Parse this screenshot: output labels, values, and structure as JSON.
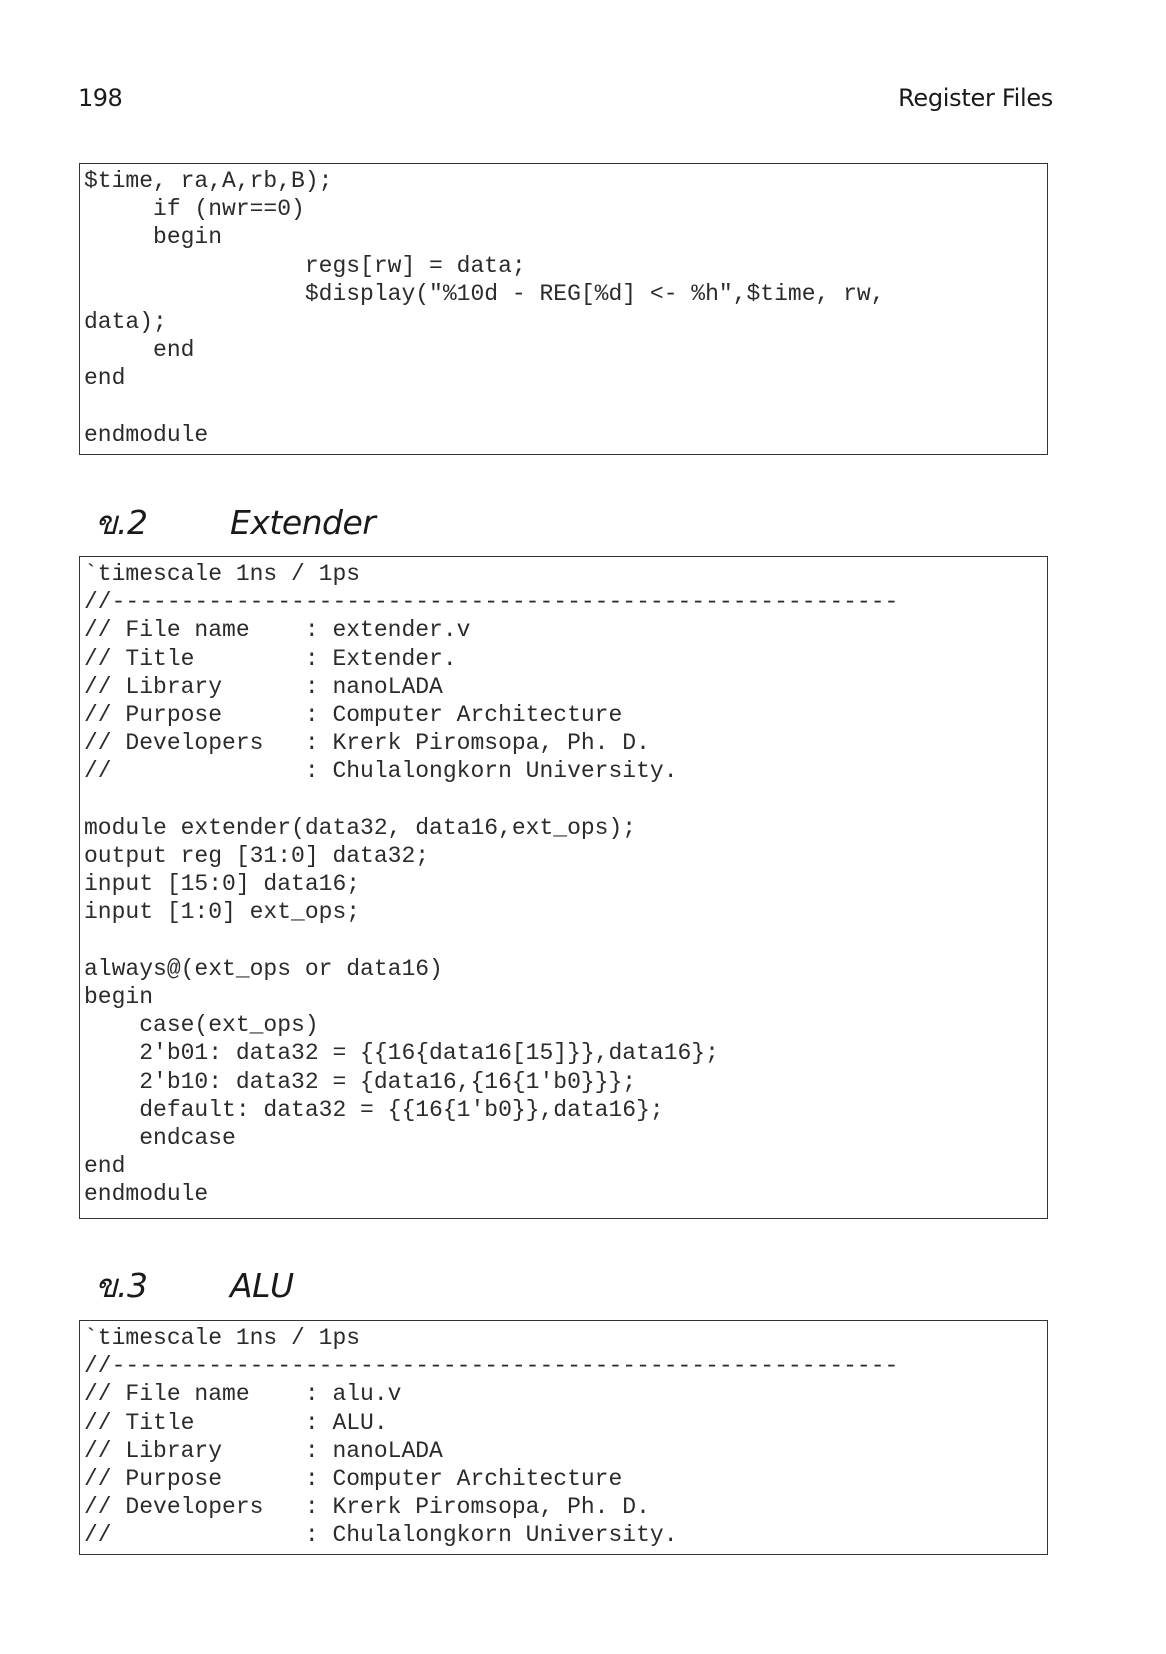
{
  "header": {
    "page_number": "198",
    "chapter_title": "Register Files"
  },
  "listings": {
    "register_file_tail": "$time, ra,A,rb,B);\n     if (nwr==0)\n     begin\n                regs[rw] = data;\n                $display(\"%10d - REG[%d] <- %h\",$time, rw,\ndata);\n     end\nend\n\nendmodule",
    "extender": "`timescale 1ns / 1ps\n//---------------------------------------------------------\n// File name    : extender.v\n// Title        : Extender.\n// Library      : nanoLADA\n// Purpose      : Computer Architecture\n// Developers   : Krerk Piromsopa, Ph. D.\n//              : Chulalongkorn University.\n\nmodule extender(data32, data16,ext_ops);\noutput reg [31:0] data32;\ninput [15:0] data16;\ninput [1:0] ext_ops;\n\nalways@(ext_ops or data16)\nbegin\n    case(ext_ops)\n    2'b01: data32 = {{16{data16[15]}},data16};\n    2'b10: data32 = {data16,{16{1'b0}}};\n    default: data32 = {{16{1'b0}},data16};\n    endcase\nend\nendmodule",
    "alu": "`timescale 1ns / 1ps\n//---------------------------------------------------------\n// File name    : alu.v\n// Title        : ALU.\n// Library      : nanoLADA\n// Purpose      : Computer Architecture\n// Developers   : Krerk Piromsopa, Ph. D.\n//              : Chulalongkorn University."
  },
  "sections": {
    "extender": {
      "number": "ข.2",
      "title": "Extender"
    },
    "alu": {
      "number": "ข.3",
      "title": "ALU"
    }
  }
}
